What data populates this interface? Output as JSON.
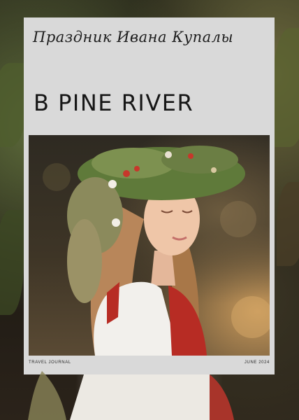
{
  "poster": {
    "handwritten_title": "Праздник Ивана Купалы",
    "headline": "В PINE RIVER",
    "footer_left": "TRAVEL JOURNAL",
    "footer_right": "JUNE 2024"
  },
  "colors": {
    "card": "#d9d9d9",
    "text": "#161616",
    "background": "#1f1b16"
  }
}
